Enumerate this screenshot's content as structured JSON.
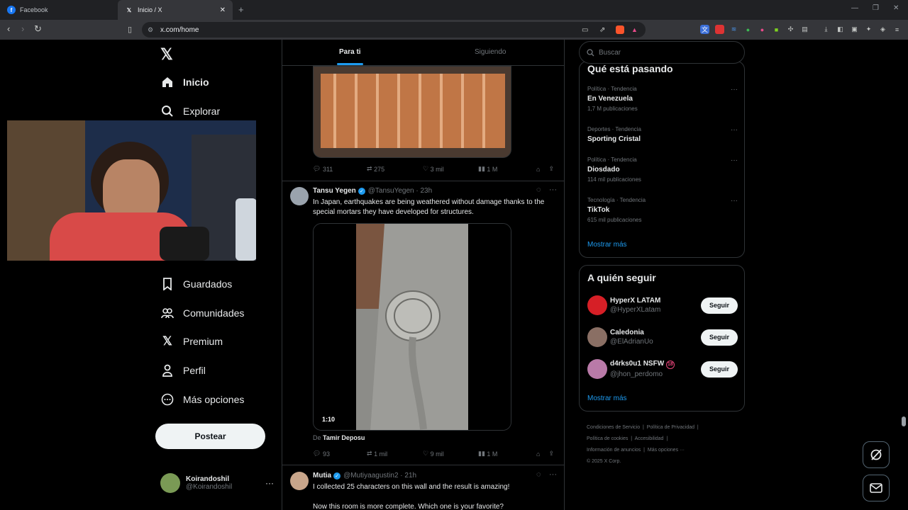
{
  "browser": {
    "tabs": [
      {
        "title": "Facebook"
      },
      {
        "title": "Inicio / X"
      }
    ],
    "url": "x.com/home"
  },
  "nav": {
    "items": [
      {
        "label": "Inicio"
      },
      {
        "label": "Explorar"
      },
      {
        "label": "Guardados"
      },
      {
        "label": "Comunidades"
      },
      {
        "label": "Premium"
      },
      {
        "label": "Perfil"
      },
      {
        "label": "Más opciones"
      }
    ],
    "post_label": "Postear",
    "account_name": "Koirandoshil",
    "account_handle": "@Koirandoshil"
  },
  "timeline": {
    "tabs": [
      "Para ti",
      "Siguiendo"
    ],
    "tweet0": {
      "replies": "311",
      "reposts": "275",
      "likes": "3 mil",
      "views": "1 M"
    },
    "tweet1": {
      "name": "Tansu Yegen",
      "handle": "@TansuYegen · 23h",
      "text": "In Japan, earthquakes are being weathered without damage thanks to the special mortars they have developed for structures.",
      "duration": "1:10",
      "credit_prefix": "De",
      "credit_name": "Tamir Deposu",
      "replies": "93",
      "reposts": "1 mil",
      "likes": "9 mil",
      "views": "1 M"
    },
    "tweet2": {
      "name": "Mutia",
      "handle": "@Mutiyaagustin2 · 21h",
      "text1": "I collected 25 characters on this wall and the result is amazing!",
      "text2": "Now this room is more complete. Which one is your favorite?"
    }
  },
  "sidebar": {
    "search_placeholder": "Buscar",
    "trends_title": "Qué está pasando",
    "trends": [
      {
        "category": "Política · Tendencia",
        "title": "En Venezuela",
        "count": "1,7 M publicaciones"
      },
      {
        "category": "Deportes · Tendencia",
        "title": "Sporting Cristal",
        "count": ""
      },
      {
        "category": "Política · Tendencia",
        "title": "Diosdado",
        "count": "114 mil publicaciones"
      },
      {
        "category": "Tecnología · Tendencia",
        "title": "TikTok",
        "count": "615 mil publicaciones"
      }
    ],
    "show_more": "Mostrar más",
    "who_title": "A quién seguir",
    "who": [
      {
        "name": "HyperX LATAM",
        "handle": "@HyperXLatam",
        "color": "#d61f26"
      },
      {
        "name": "Caledonia",
        "handle": "@ElAdrianUo",
        "color": "#8a6f64"
      },
      {
        "name": "d4rks0u1 NSFW",
        "handle": "@jhon_perdomo",
        "color": "#b97aa8",
        "badge": "18"
      }
    ],
    "follow_label": "Seguir",
    "footer": {
      "l1a": "Condiciones de Servicio",
      "l1b": "Política de Privacidad",
      "l2a": "Política de cookies",
      "l2b": "Accesibilidad",
      "l3a": "Información de anuncios",
      "l3b": "Más opciones ···",
      "l4": "© 2025 X Corp."
    }
  },
  "colors": {
    "accent": "#1d9bf0",
    "border": "#2f3336",
    "muted": "#71767b"
  }
}
